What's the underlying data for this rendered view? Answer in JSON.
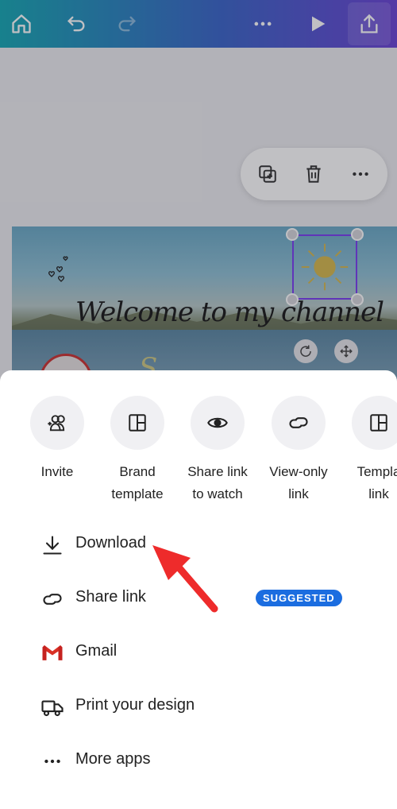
{
  "toolbar": {
    "home_icon": "home-icon",
    "undo_icon": "undo-icon",
    "redo_icon": "redo-icon",
    "more_icon": "more-horizontal-icon",
    "play_icon": "play-icon",
    "share_icon": "share-upload-icon"
  },
  "canvas": {
    "design_text": "Welcome to my channel",
    "floating_tools": [
      "duplicate-icon",
      "trash-icon",
      "more-horizontal-icon"
    ]
  },
  "share_sheet": {
    "options": [
      {
        "label": "Invite",
        "icon": "add-people-icon"
      },
      {
        "label": "Brand\ntemplate",
        "icon": "template-icon"
      },
      {
        "label": "Share link\nto watch",
        "icon": "eye-icon"
      },
      {
        "label": "View-only\nlink",
        "icon": "link-icon"
      },
      {
        "label": "Templa\nlink",
        "icon": "template-icon"
      }
    ],
    "list": [
      {
        "label": "Download",
        "icon": "download-icon"
      },
      {
        "label": "Share link",
        "icon": "link-icon",
        "badge": "SUGGESTED"
      },
      {
        "label": "Gmail",
        "icon": "gmail-icon"
      },
      {
        "label": "Print your design",
        "icon": "truck-icon"
      },
      {
        "label": "More apps",
        "icon": "more-horizontal-icon"
      }
    ]
  },
  "colors": {
    "accent": "#1b6de0",
    "selection": "#7a3ff2",
    "annotation_arrow": "#ee2b2b"
  }
}
